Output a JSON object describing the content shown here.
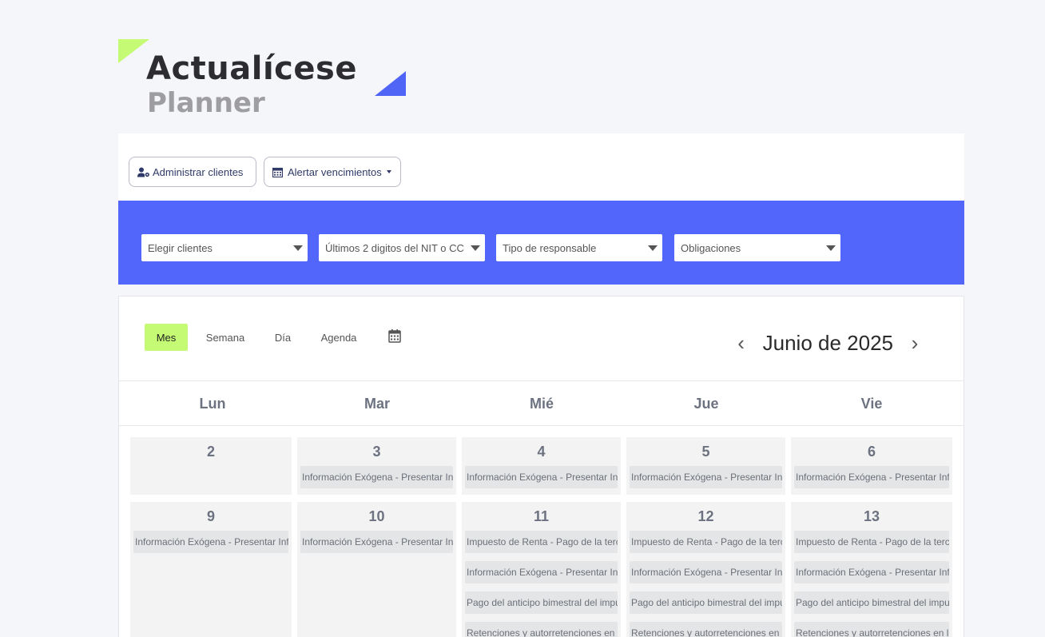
{
  "logo": {
    "brand": "Actualícese",
    "product": "Planner"
  },
  "toolbar": {
    "clients_label": "Administrar clientes",
    "alert_label": "Alertar vencimientos"
  },
  "filters": {
    "clients": "Elegir clientes",
    "nit": "Últimos 2 digitos del NIT o CC",
    "responsible": "Tipo de responsable",
    "obligations": "Obligaciones"
  },
  "calendar": {
    "views": [
      "Mes",
      "Semana",
      "Día",
      "Agenda"
    ],
    "active_view": "Mes",
    "title": "Junio de 2025",
    "prev": "‹",
    "next": "›",
    "days_of_week": [
      "Lun",
      "Mar",
      "Mié",
      "Jue",
      "Vie"
    ],
    "weeks": [
      {
        "days": [
          {
            "num": "2",
            "events": []
          },
          {
            "num": "3",
            "events": [
              "Información Exógena - Presentar Información"
            ]
          },
          {
            "num": "4",
            "events": [
              "Información Exógena - Presentar Información"
            ]
          },
          {
            "num": "5",
            "events": [
              "Información Exógena - Presentar Información"
            ]
          },
          {
            "num": "6",
            "events": [
              "Información Exógena - Presentar Información"
            ]
          }
        ]
      },
      {
        "days": [
          {
            "num": "9",
            "events": [
              "Información Exógena - Presentar Información"
            ]
          },
          {
            "num": "10",
            "events": [
              "Información Exógena - Presentar Información"
            ]
          },
          {
            "num": "11",
            "events": [
              "Impuesto de Renta - Pago de la tercera cuota",
              "Información Exógena - Presentar Información",
              "Pago del anticipo bimestral del impuesto",
              "Retenciones y autorretenciones en la fuente"
            ]
          },
          {
            "num": "12",
            "events": [
              "Impuesto de Renta - Pago de la tercera cuota",
              "Información Exógena - Presentar Información",
              "Pago del anticipo bimestral del impuesto",
              "Retenciones y autorretenciones en la fuente"
            ]
          },
          {
            "num": "13",
            "events": [
              "Impuesto de Renta - Pago de la tercera cuota",
              "Información Exógena - Presentar Información",
              "Pago del anticipo bimestral del impuesto",
              "Retenciones y autorretenciones en la fuente"
            ]
          }
        ]
      }
    ]
  },
  "colors": {
    "accent_green": "#c5fb74",
    "accent_blue": "#5366fb",
    "button_text": "#2f3a68"
  }
}
